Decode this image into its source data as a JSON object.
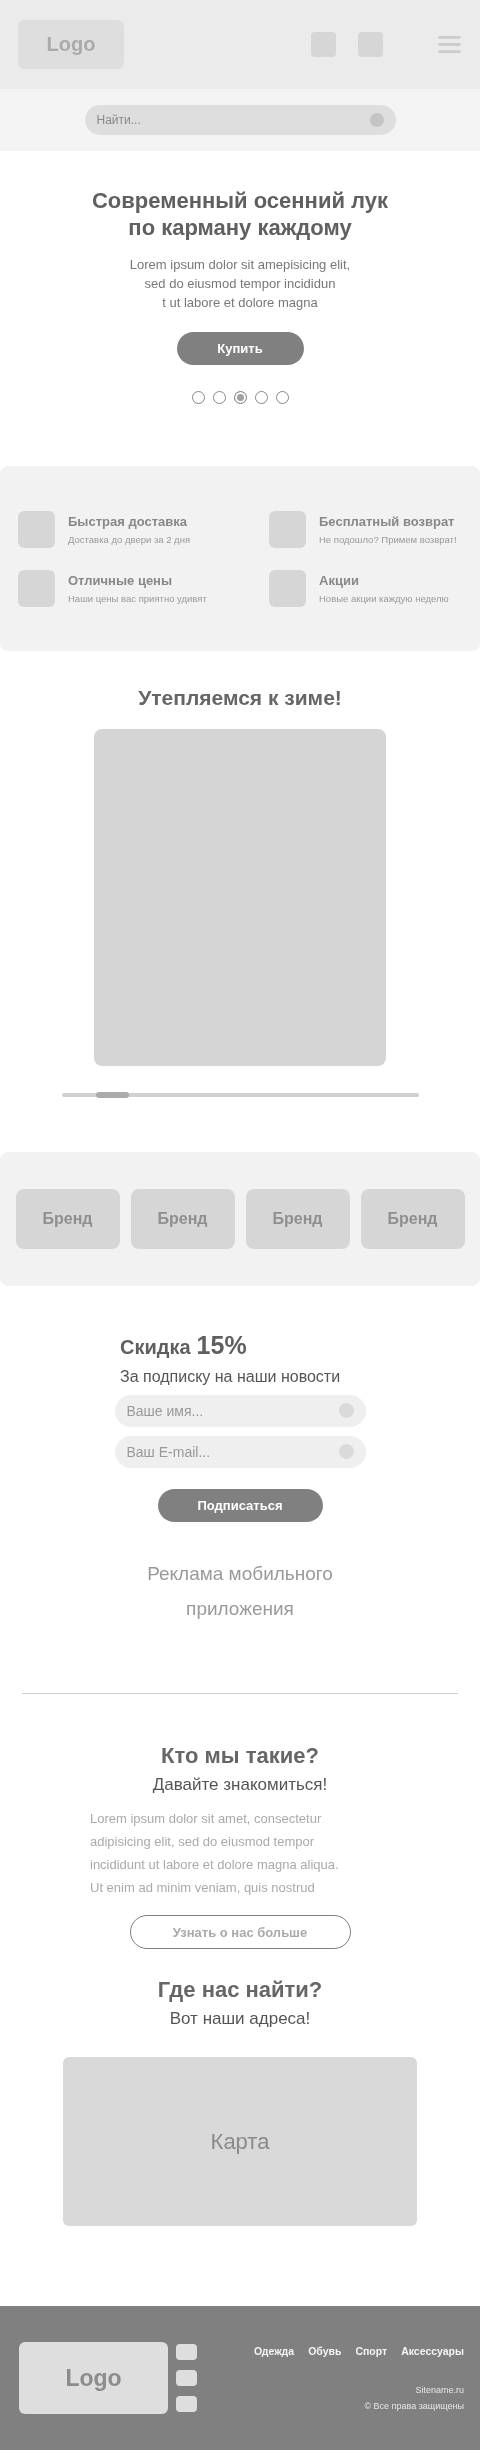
{
  "header": {
    "logo": "Logo",
    "search": {
      "placeholder": "Найти..."
    }
  },
  "hero": {
    "title": "Современный осенний лук по карману каждому",
    "text": "Lorem ipsum dolor sit amepisicing elit,\nsed do eiusmod tempor incididun\nt ut labore et dolore magna",
    "button": "Купить",
    "slides": [
      {
        "selected": false
      },
      {
        "selected": false
      },
      {
        "selected": true
      },
      {
        "selected": false
      },
      {
        "selected": false
      }
    ]
  },
  "features": [
    {
      "title": "Быстрая доставка",
      "text": "Доставка до двери за 2 дня"
    },
    {
      "title": "Бесплатный возврат",
      "text": "Не подошло? Примем возврат!"
    },
    {
      "title": "Отличные цены",
      "text": "Наши цены вас приятно удивят"
    },
    {
      "title": "Акции",
      "text": "Новые акции каждую неделю"
    }
  ],
  "promo": {
    "title": "Утепляемся к зиме!"
  },
  "brands": [
    "Бренд",
    "Бренд",
    "Бренд",
    "Бренд"
  ],
  "subscribe": {
    "label": "Скидка",
    "value": "15%",
    "subtitle": "За подписку на наши новости",
    "fields": [
      {
        "placeholder": "Ваше имя..."
      },
      {
        "placeholder": "Ваш E-mail..."
      }
    ],
    "button": "Подписаться"
  },
  "app_ad": "Реклама мобильного\nприложения",
  "about": {
    "title": "Кто мы такие?",
    "subtitle": "Давайте знакомиться!",
    "text": "Lorem ipsum dolor sit amet, consectetur\nadipisicing elit, sed do eiusmod tempor\nincididunt ut labore et dolore magna aliqua.\nUt enim ad minim veniam, quis nostrud",
    "button": "Узнать о нас больше"
  },
  "location": {
    "title": "Где нас найти?",
    "subtitle": "Вот наши адреса!",
    "map": "Карта"
  },
  "footer": {
    "logo": "Logo",
    "nav": [
      "Одежда",
      "Обувь",
      "Спорт",
      "Аксессуары"
    ],
    "site": "Sitename.ru",
    "copyright": "© Все права защищены"
  }
}
